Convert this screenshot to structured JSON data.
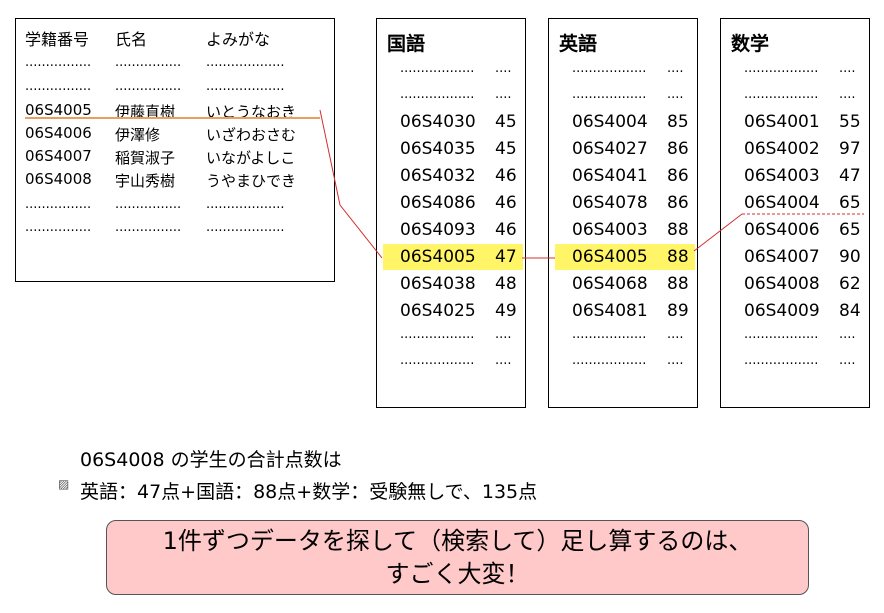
{
  "students": {
    "headers": [
      "学籍番号",
      "氏名",
      "よみがな"
    ],
    "dots": [
      "................",
      "................",
      "..................."
    ],
    "rows": [
      {
        "id": "06S4005",
        "name": "伊藤直樹",
        "yomi": "いとうなおき"
      },
      {
        "id": "06S4006",
        "name": "伊澤修",
        "yomi": "いざわおさむ"
      },
      {
        "id": "06S4007",
        "name": "稲賀淑子",
        "yomi": "いながよしこ"
      },
      {
        "id": "06S4008",
        "name": "宇山秀樹",
        "yomi": "うやまひでき"
      }
    ]
  },
  "subjects": [
    {
      "title": "国語",
      "dots": [
        "..................",
        "...."
      ],
      "rows": [
        {
          "id": "06S4030",
          "score": "45"
        },
        {
          "id": "06S4035",
          "score": "45"
        },
        {
          "id": "06S4032",
          "score": "46"
        },
        {
          "id": "06S4086",
          "score": "46"
        },
        {
          "id": "06S4093",
          "score": "46"
        },
        {
          "id": "06S4005",
          "score": "47",
          "highlight": true
        },
        {
          "id": "06S4038",
          "score": "48"
        },
        {
          "id": "06S4025",
          "score": "49"
        }
      ]
    },
    {
      "title": "英語",
      "dots": [
        "..................",
        "...."
      ],
      "rows": [
        {
          "id": "06S4004",
          "score": "85"
        },
        {
          "id": "06S4027",
          "score": "86"
        },
        {
          "id": "06S4041",
          "score": "86"
        },
        {
          "id": "06S4078",
          "score": "86"
        },
        {
          "id": "06S4003",
          "score": "88"
        },
        {
          "id": "06S4005",
          "score": "88",
          "highlight": true
        },
        {
          "id": "06S4068",
          "score": "88"
        },
        {
          "id": "06S4081",
          "score": "89"
        }
      ]
    },
    {
      "title": "数学",
      "dots": [
        "..................",
        "...."
      ],
      "rows": [
        {
          "id": "06S4001",
          "score": "55"
        },
        {
          "id": "06S4002",
          "score": "97"
        },
        {
          "id": "06S4003",
          "score": "47"
        },
        {
          "id": "06S4004",
          "score": "65"
        },
        {
          "id": "06S4006",
          "score": "65"
        },
        {
          "id": "06S4007",
          "score": "90"
        },
        {
          "id": "06S4008",
          "score": "62"
        },
        {
          "id": "06S4009",
          "score": "84"
        }
      ]
    }
  ],
  "caption": {
    "line1": "06S4008 の学生の合計点数は",
    "line2": "英語：47点+国語：88点+数学：受験無しで、135点"
  },
  "callout": {
    "line1": "1件ずつデータを探して（検索して）足し算するのは、",
    "line2": "すごく大変！"
  },
  "colors": {
    "highlight": "#fff566",
    "callout_bg": "#ffc9c9",
    "link_line": "#d03030",
    "underline": "#e8a060"
  }
}
